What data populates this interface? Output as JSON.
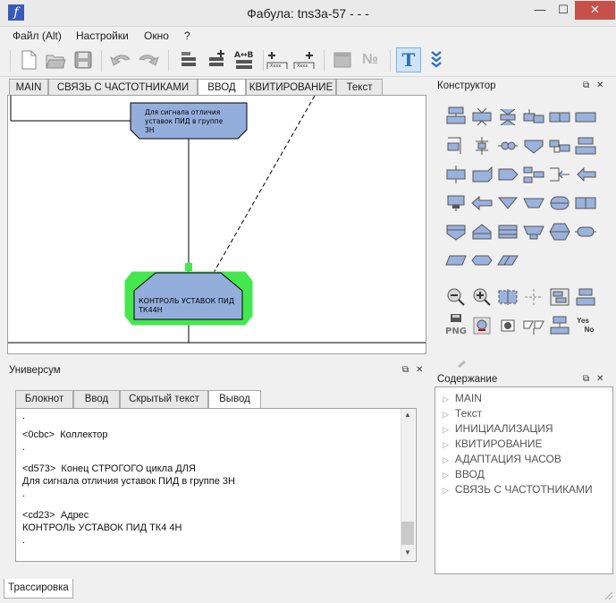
{
  "window": {
    "title": "Фабула: tns3a-57 - - -",
    "minimize": "—",
    "maximize": "☐",
    "close": "✕"
  },
  "menu": [
    {
      "label": "Файл (Alt)"
    },
    {
      "label": "Настройки"
    },
    {
      "label": "Окно"
    },
    {
      "label": "?"
    }
  ],
  "toolbar": {
    "icons": [
      "new-file-icon",
      "open-folder-icon",
      "save-icon",
      "undo-icon",
      "redo-icon",
      "insert-above-icon",
      "insert-below-icon",
      "swap-ab-icon",
      "add-left-icon",
      "add-right-icon",
      "block-disabled-icon",
      "number-icon",
      "text-mode-icon",
      "expand-icon"
    ],
    "labels": {
      "swap": "A↔B",
      "number": "№",
      "text_mode": "T"
    }
  },
  "doc_tabs": [
    {
      "label": "MAIN"
    },
    {
      "label": "СВЯЗЬ С ЧАСТОТНИКАМИ"
    },
    {
      "label": "ВВОД",
      "active": true
    },
    {
      "label": "КВИТИРОВАНИЕ"
    },
    {
      "label": "Текст"
    }
  ],
  "diagram": {
    "block1_lines": [
      "Для сигнала отличия",
      "уставок ПИД в группе",
      "3Н"
    ],
    "block2_lines": [
      "КОНТРОЛЬ УСТАВОК ПИД",
      "ТК44Н"
    ],
    "block_fill": "#94aedb",
    "selection_color": "#44e84e"
  },
  "constructor": {
    "title": "Конструктор",
    "png_label": "PNG",
    "yes_label": "Yes",
    "no_label": "No"
  },
  "universe": {
    "title": "Универсум",
    "tabs": [
      {
        "label": "Блокнот"
      },
      {
        "label": "Ввод"
      },
      {
        "label": "Скрытый текст"
      },
      {
        "label": "Вывод",
        "active": true
      }
    ],
    "output_lines": [
      ".",
      "",
      "<0cbc>  Коллектор",
      ".",
      "",
      "<d573>  Конец СТРОГОГО цикла ДЛЯ",
      "Для сигнала отличия уставок ПИД в группе 3Н",
      ".",
      "",
      "<cd23>  Адрес",
      "КОНТРОЛЬ УСТАВОК ПИД ТК4 4Н",
      "."
    ]
  },
  "contents": {
    "title": "Содержание",
    "items": [
      "MAIN",
      "Текст",
      "ИНИЦИАЛИЗАЦИЯ",
      "КВИТИРОВАНИЕ",
      "АДАПТАЦИЯ ЧАСОВ",
      "ВВОД",
      "СВЯЗЬ С ЧАСТОТНИКАМИ"
    ]
  },
  "bottom_tab": "Трассировка"
}
